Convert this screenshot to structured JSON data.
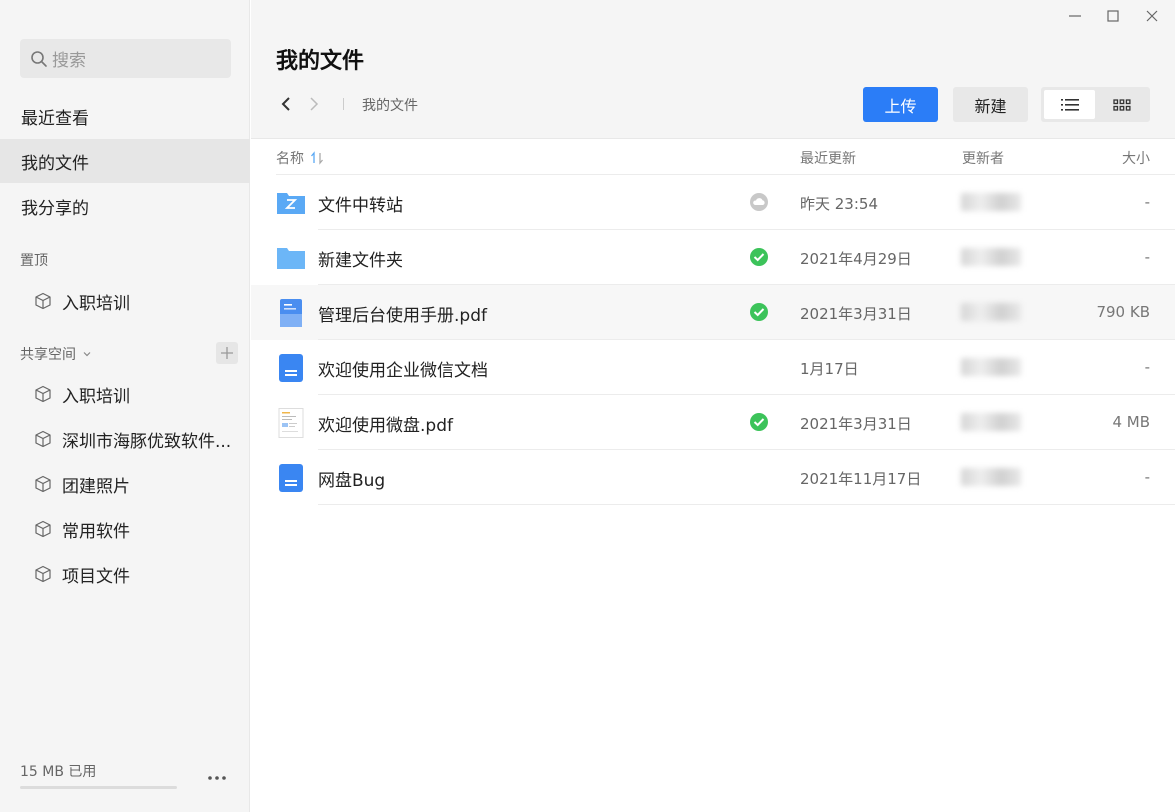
{
  "sidebar": {
    "search_placeholder": "搜索",
    "nav": [
      {
        "label": "最近查看"
      },
      {
        "label": "我的文件"
      },
      {
        "label": "我分享的"
      }
    ],
    "pinned_label": "置顶",
    "pinned_items": [
      {
        "label": "入职培训"
      }
    ],
    "shared_space_label": "共享空间",
    "shared_items": [
      {
        "label": "入职培训"
      },
      {
        "label": "深圳市海豚优致软件..."
      },
      {
        "label": "团建照片"
      },
      {
        "label": "常用软件"
      },
      {
        "label": "项目文件"
      }
    ],
    "storage_label": "15 MB 已用",
    "storage_used_fraction": 0.0
  },
  "header": {
    "title": "我的文件",
    "breadcrumb": "我的文件",
    "upload_label": "上传",
    "new_label": "新建"
  },
  "table": {
    "columns": {
      "name": "名称",
      "updated": "最近更新",
      "updater": "更新者",
      "size": "大小"
    },
    "rows": [
      {
        "name": "文件中转站",
        "date": "昨天 23:54",
        "size": "-",
        "icon": "transfer-folder-icon",
        "sync": "cloud"
      },
      {
        "name": "新建文件夹",
        "date": "2021年4月29日",
        "size": "-",
        "icon": "folder-icon",
        "sync": "synced"
      },
      {
        "name": "管理后台使用手册.pdf",
        "date": "2021年3月31日",
        "size": "790 KB",
        "icon": "pdf-icon",
        "sync": "synced"
      },
      {
        "name": "欢迎使用企业微信文档",
        "date": "1月17日",
        "size": "-",
        "icon": "doc-icon",
        "sync": "none"
      },
      {
        "name": "欢迎使用微盘.pdf",
        "date": "2021年3月31日",
        "size": "4 MB",
        "icon": "pdf-thumbnail-icon",
        "sync": "synced"
      },
      {
        "name": "网盘Bug",
        "date": "2021年11月17日",
        "size": "-",
        "icon": "doc-icon",
        "sync": "none"
      }
    ]
  },
  "colors": {
    "accent": "#2b7df7",
    "synced": "#3cc35a",
    "folder": "#5aa9f5"
  }
}
